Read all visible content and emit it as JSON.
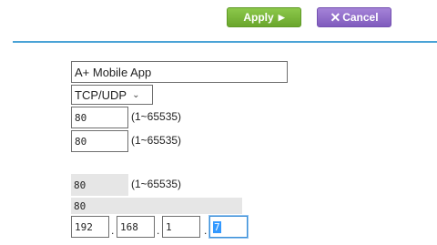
{
  "toolbar": {
    "apply_label": "Apply",
    "apply_glyph": "▶",
    "cancel_glyph": "✕",
    "cancel_label": "Cancel",
    "apply_color": "#7ab73a",
    "cancel_color": "#8f6bcb"
  },
  "form": {
    "service_name": "A+ Mobile App",
    "protocol": "TCP/UDP",
    "external_start_port": "80",
    "external_port_hint": "(1~65535)",
    "external_end_port": "80",
    "external_end_port_hint": "(1~65535)",
    "internal_start_port": "80",
    "internal_port_hint": "(1~65535)",
    "internal_end_port": "80",
    "ip": {
      "octet1": "192",
      "octet2": "168",
      "octet3": "1",
      "octet4": "7"
    }
  }
}
